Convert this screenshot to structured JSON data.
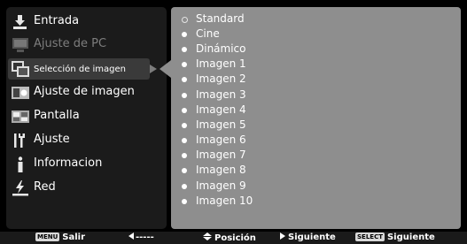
{
  "left_menu": {
    "items": [
      {
        "label": "Entrada",
        "icon": "input-arrow-icon"
      },
      {
        "label": "Ajuste de PC",
        "icon": "pc-monitor-icon"
      },
      {
        "label": "Selección de imagen",
        "icon": "image-select-icon"
      },
      {
        "label": "Ajuste de imagen",
        "icon": "image-adjust-icon"
      },
      {
        "label": "Pantalla",
        "icon": "screen-icon"
      },
      {
        "label": "Ajuste",
        "icon": "wrench-icon"
      },
      {
        "label": "Informacion",
        "icon": "info-icon"
      },
      {
        "label": "Red",
        "icon": "network-icon"
      }
    ],
    "selected_index": 2,
    "disabled_index": 1
  },
  "submenu": {
    "options": [
      "Standard",
      "Cine",
      "Dinámico",
      "Imagen 1",
      "Imagen 2",
      "Imagen 3",
      "Imagen 4",
      "Imagen 5",
      "Imagen 6",
      "Imagen 7",
      "Imagen 8",
      "Imagen 9",
      "Imagen 10"
    ],
    "active_index": 0
  },
  "bottom_bar": {
    "exit_key": "MENU",
    "exit_label": "Salir",
    "back_label": "-----",
    "position_label": "Posición",
    "next_label": "Siguiente",
    "select_key": "SELECT",
    "select_label": "Siguiente"
  },
  "colors": {
    "background": "#000000",
    "left_panel": "#1b1b1b",
    "right_panel": "#8e8e8e",
    "text": "#ffffff",
    "disabled_text": "#7e7e7e"
  }
}
